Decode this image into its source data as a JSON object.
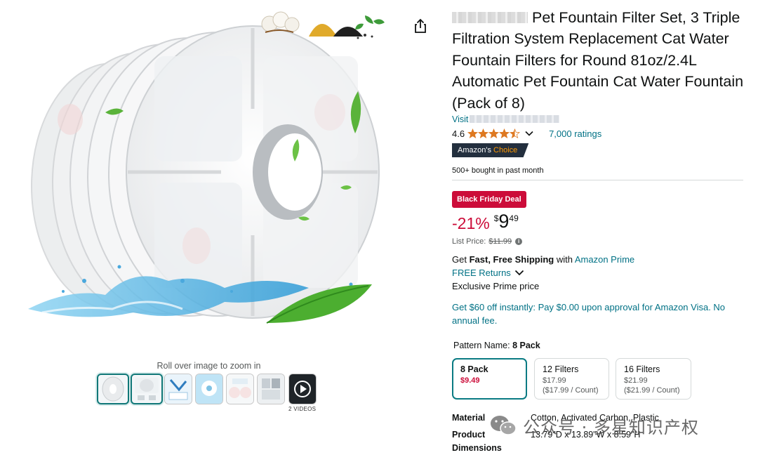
{
  "product": {
    "title": "Pet Fountain Filter Set, 3 Triple Filtration System Replacement Cat Water Fountain Filters for Round 81oz/2.4L Automatic Pet Fountain Cat Water Fountain (Pack of 8)",
    "visit_prefix": "Visit",
    "rating_value": "4.6",
    "rating_stars": 4.5,
    "ratings_count": "7,000 ratings",
    "badge_prefix": "Amazon's",
    "badge_suffix": "Choice",
    "bought_text": "500+ bought in past month"
  },
  "pricing": {
    "deal_badge": "Black Friday Deal",
    "discount": "-21%",
    "currency": "$",
    "whole": "9",
    "fraction": "49",
    "list_label": "List Price:",
    "list_value": "$11.99",
    "info_icon": "i"
  },
  "shipping": {
    "get": "Get",
    "fast": "Fast, Free Shipping",
    "with": "with",
    "prime_link": "Amazon Prime",
    "free_returns": "FREE Returns",
    "exclusive": "Exclusive Prime price",
    "visa_offer": "Get $60 off instantly: Pay $0.00 upon approval for Amazon Visa. No annual fee."
  },
  "pattern": {
    "label": "Pattern Name:",
    "selected": "8 Pack",
    "options": [
      {
        "name": "8 Pack",
        "price": "$9.49",
        "unit": ""
      },
      {
        "name": "12 Filters",
        "price": "$17.99",
        "unit": "($17.99 / Count)"
      },
      {
        "name": "16 Filters",
        "price": "$21.99",
        "unit": "($21.99 / Count)"
      }
    ]
  },
  "specs": {
    "material_label": "Material",
    "material_value": "Cotton, Activated Carbon, Plastic",
    "dims_label_1": "Product",
    "dims_label_2": "Dimensions",
    "dims_value": "13.79\"D x 13.89\"W x 8.59\"H"
  },
  "gallery": {
    "zoom_hint": "Roll over image to zoom in",
    "videos_label": "2 VIDEOS",
    "thumb_count": 8,
    "selected_index": 0
  },
  "watermark": "公众号 · 多星知识产权",
  "colors": {
    "link": "#007185",
    "deal": "#cc0c39",
    "star": "#de7921",
    "badge_bg": "#232f3e",
    "badge_accent": "#ff9900",
    "selected_border": "#0a7b83"
  }
}
